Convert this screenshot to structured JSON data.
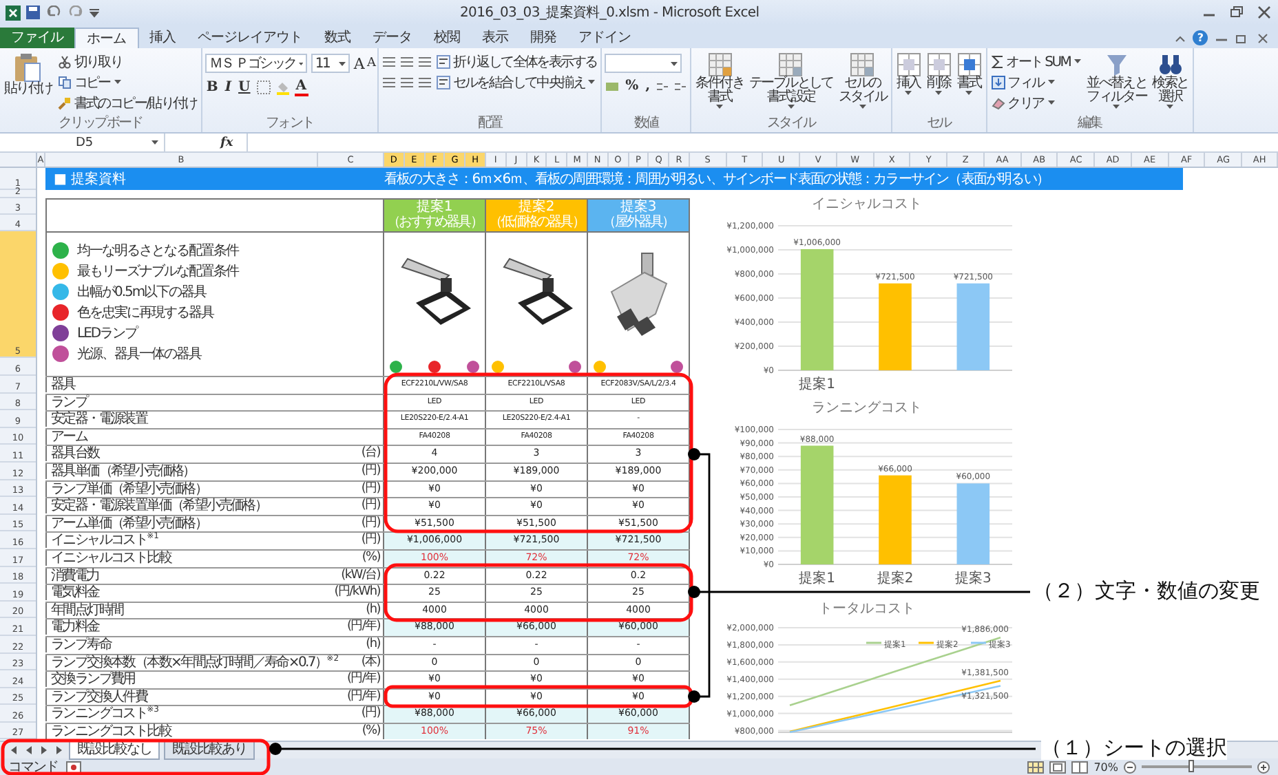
{
  "window": {
    "title": "2016_03_03_提案資料_0.xlsm - Microsoft Excel",
    "help": "?"
  },
  "ribbon_tabs": [
    {
      "label": "ファイル",
      "kind": "file",
      "selected": false
    },
    {
      "label": "ホーム",
      "kind": "tab",
      "selected": true
    },
    {
      "label": "挿入",
      "kind": "tab",
      "selected": false
    },
    {
      "label": "ページレイアウト",
      "kind": "tab",
      "selected": false
    },
    {
      "label": "数式",
      "kind": "tab",
      "selected": false
    },
    {
      "label": "データ",
      "kind": "tab",
      "selected": false
    },
    {
      "label": "校閲",
      "kind": "tab",
      "selected": false
    },
    {
      "label": "表示",
      "kind": "tab",
      "selected": false
    },
    {
      "label": "開発",
      "kind": "tab",
      "selected": false
    },
    {
      "label": "アドイン",
      "kind": "tab",
      "selected": false
    }
  ],
  "ribbon_groups": [
    {
      "kind": "clipboard",
      "label": "クリップボード",
      "paste": "貼り付け",
      "items": [
        {
          "text": "切り取り",
          "dropdown": false
        },
        {
          "text": "コピー",
          "dropdown": true
        },
        {
          "text": "書式のコピー/貼り付け",
          "dropdown": false
        }
      ]
    },
    {
      "kind": "font",
      "label": "フォント",
      "font_name": "ＭＳ Ｐゴシック",
      "font_size": "11",
      "size_buttons": [
        "A",
        "A"
      ],
      "styles": [
        "B",
        "I",
        "U"
      ],
      "color_button": "A"
    },
    {
      "kind": "alignment",
      "label": "配置",
      "items": [
        {
          "text": "折り返して全体を表示する",
          "dropdown": false
        },
        {
          "text": "セルを結合して中央揃え",
          "dropdown": true
        }
      ]
    },
    {
      "kind": "number",
      "label": "数値",
      "symbols": [
        "%",
        ","
      ]
    },
    {
      "kind": "styles",
      "label": "スタイル",
      "items": [
        {
          "lines": [
            "条件付き",
            "書式"
          ],
          "dropdown": true
        },
        {
          "lines": [
            "テーブルとして",
            "書式設定"
          ],
          "dropdown": true
        },
        {
          "lines": [
            "セルの",
            "スタイル"
          ],
          "dropdown": true
        }
      ]
    },
    {
      "kind": "cells",
      "label": "セル",
      "items": [
        {
          "lines": [
            "挿入"
          ],
          "dropdown": true
        },
        {
          "lines": [
            "削除"
          ],
          "dropdown": true
        },
        {
          "lines": [
            "書式"
          ],
          "dropdown": true
        }
      ]
    },
    {
      "kind": "editing",
      "label": "編集",
      "small": [
        {
          "text": "オート SUM",
          "dropdown": true
        },
        {
          "text": "フィル",
          "dropdown": true
        },
        {
          "text": "クリア",
          "dropdown": true
        }
      ],
      "items": [
        {
          "lines": [
            "並べ替えと",
            "フィルター"
          ],
          "dropdown": true
        },
        {
          "lines": [
            "検索と",
            "選択"
          ],
          "dropdown": true
        }
      ]
    }
  ],
  "formula_bar": {
    "name_box": "D5",
    "function_label": "fx"
  },
  "column_headers": [
    {
      "label": "A",
      "selected": false
    },
    {
      "label": "B",
      "selected": false
    },
    {
      "label": "C",
      "selected": false
    },
    {
      "label": "D",
      "selected": true
    },
    {
      "label": "E",
      "selected": true
    },
    {
      "label": "F",
      "selected": true
    },
    {
      "label": "G",
      "selected": true
    },
    {
      "label": "H",
      "selected": true
    },
    {
      "label": "I",
      "selected": false
    },
    {
      "label": "J",
      "selected": false
    },
    {
      "label": "K",
      "selected": false
    },
    {
      "label": "L",
      "selected": false
    },
    {
      "label": "M",
      "selected": false
    },
    {
      "label": "N",
      "selected": false
    },
    {
      "label": "O",
      "selected": false
    },
    {
      "label": "P",
      "selected": false
    },
    {
      "label": "Q",
      "selected": false
    },
    {
      "label": "R",
      "selected": false
    },
    {
      "label": "S",
      "selected": false
    },
    {
      "label": "T",
      "selected": false
    },
    {
      "label": "U",
      "selected": false
    },
    {
      "label": "V",
      "selected": false
    },
    {
      "label": "W",
      "selected": false
    },
    {
      "label": "X",
      "selected": false
    },
    {
      "label": "Y",
      "selected": false
    },
    {
      "label": "Z",
      "selected": false
    },
    {
      "label": "AA",
      "selected": false
    },
    {
      "label": "AB",
      "selected": false
    },
    {
      "label": "AC",
      "selected": false
    },
    {
      "label": "AD",
      "selected": false
    },
    {
      "label": "AE",
      "selected": false
    },
    {
      "label": "AF",
      "selected": false
    },
    {
      "label": "AG",
      "selected": false
    },
    {
      "label": "AH",
      "selected": false
    }
  ],
  "row_headers": [
    {
      "label": "1",
      "selected": false
    },
    {
      "label": "2",
      "selected": false
    },
    {
      "label": "3",
      "selected": false
    },
    {
      "label": "4",
      "selected": false
    },
    {
      "label": "5",
      "selected": true
    },
    {
      "label": "6",
      "selected": false
    },
    {
      "label": "7",
      "selected": false
    },
    {
      "label": "8",
      "selected": false
    },
    {
      "label": "9",
      "selected": false
    },
    {
      "label": "10",
      "selected": false
    },
    {
      "label": "11",
      "selected": false
    },
    {
      "label": "12",
      "selected": false
    },
    {
      "label": "13",
      "selected": false
    },
    {
      "label": "14",
      "selected": false
    },
    {
      "label": "15",
      "selected": false
    },
    {
      "label": "16",
      "selected": false
    },
    {
      "label": "17",
      "selected": false
    },
    {
      "label": "18",
      "selected": false
    },
    {
      "label": "19",
      "selected": false
    },
    {
      "label": "20",
      "selected": false
    },
    {
      "label": "21",
      "selected": false
    },
    {
      "label": "22",
      "selected": false
    },
    {
      "label": "23",
      "selected": false
    },
    {
      "label": "24",
      "selected": false
    },
    {
      "label": "25",
      "selected": false
    },
    {
      "label": "26",
      "selected": false
    },
    {
      "label": "27",
      "selected": false
    }
  ],
  "sheet": {
    "title": "■ 提案資料",
    "conditions": "看板の大きさ：6ｍ×6ｍ、看板の周囲環境：周囲が明るい、サインボード表面の状態：カラーサイン（表面が明るい）",
    "proposals": [
      {
        "name": "提案1",
        "subtitle": "（おすすめ器具）",
        "color": "#92d050",
        "badges": [
          {
            "color": "#2db24a"
          },
          {
            "color": "#e8252a"
          },
          {
            "color": "#c0509a"
          }
        ]
      },
      {
        "name": "提案2",
        "subtitle": "（低価格の器具）",
        "color": "#ffc000",
        "badges": [
          {
            "color": "#ffc000"
          },
          {
            "color": "#c0509a"
          }
        ]
      },
      {
        "name": "提案3",
        "subtitle": "（屋外器具）",
        "color": "#5bb4f0",
        "badges": [
          {
            "color": "#ffc000"
          },
          {
            "color": "#c0509a"
          }
        ]
      }
    ],
    "legend": [
      {
        "text": "均一な明るさとなる配置条件",
        "color": "#2db24a"
      },
      {
        "text": "最もリーズナブルな配置条件",
        "color": "#ffc000"
      },
      {
        "text": "出幅が0.5m以下の器具",
        "color": "#35b8e8"
      },
      {
        "text": "色を忠実に再現する器具",
        "color": "#e8252a"
      },
      {
        "text": "LEDランプ",
        "color": "#7f3f98"
      },
      {
        "text": "光源、器具一体の器具",
        "color": "#c0509a"
      }
    ],
    "rows": [
      {
        "label": "器具",
        "values": [
          "ECF2210L/VW/SA8",
          "ECF2210L/VSA8",
          "ECF2083V/SA/L/2/3.4"
        ],
        "kind": "spec"
      },
      {
        "label": "ランプ",
        "values": [
          "LED",
          "LED",
          "LED"
        ],
        "kind": "spec"
      },
      {
        "label": "安定器・電源装置",
        "values": [
          "LE20S220-E/2.4-A1",
          "LE20S220-E/2.4-A1",
          "-"
        ],
        "kind": "spec"
      },
      {
        "label": "アーム",
        "values": [
          "FA40208",
          "FA40208",
          "FA40208"
        ],
        "kind": "spec"
      },
      {
        "label": "器具台数",
        "unit": "(台)",
        "values": [
          "4",
          "3",
          "3"
        ],
        "kind": "input"
      },
      {
        "label": "器具単価（希望小売価格）",
        "unit": "(円)",
        "values": [
          "¥200,000",
          "¥189,000",
          "¥189,000"
        ],
        "kind": "input"
      },
      {
        "label": "ランプ単価（希望小売価格）",
        "unit": "(円)",
        "values": [
          "¥0",
          "¥0",
          "¥0"
        ],
        "kind": "input"
      },
      {
        "label": "安定器・電源装置単価（希望小売価格）",
        "unit": "(円)",
        "values": [
          "¥0",
          "¥0",
          "¥0"
        ],
        "kind": "input"
      },
      {
        "label": "アーム単価（希望小売価格）",
        "unit": "(円)",
        "values": [
          "¥51,500",
          "¥51,500",
          "¥51,500"
        ],
        "kind": "input"
      },
      {
        "label": "イニシャルコスト$^{※1}$",
        "unit": "(円)",
        "values": [
          "¥1,006,000",
          "¥721,500",
          "¥721,500"
        ],
        "kind": "total"
      },
      {
        "label": "イニシャルコスト比較",
        "unit": "(%)",
        "values": [
          "100%",
          "72%",
          "72%"
        ],
        "kind": "ratio"
      },
      {
        "label": "消費電力",
        "unit": "(kW/台)",
        "values": [
          "0.22",
          "0.22",
          "0.2"
        ],
        "kind": "input"
      },
      {
        "label": "電気料金",
        "unit": "(円/kWh)",
        "values": [
          "25",
          "25",
          "25"
        ],
        "kind": "input"
      },
      {
        "label": "年間点灯時間",
        "unit": "(h)",
        "values": [
          "4000",
          "4000",
          "4000"
        ],
        "kind": "input"
      },
      {
        "label": "電力料金",
        "unit": "(円/年)",
        "values": [
          "¥88,000",
          "¥66,000",
          "¥60,000"
        ],
        "kind": "total"
      },
      {
        "label": "ランプ寿命",
        "unit": "(h)",
        "values": [
          "-",
          "-",
          "-"
        ],
        "kind": "input"
      },
      {
        "label": "ランプ交換本数（本数×年間点灯時間／寿命×0.7）$^{※2}$",
        "unit": "(本)",
        "values": [
          "0",
          "0",
          "0"
        ],
        "kind": "input"
      },
      {
        "label": "交換ランプ費用",
        "unit": "(円/年)",
        "values": [
          "¥0",
          "¥0",
          "¥0"
        ],
        "kind": "input"
      },
      {
        "label": "ランプ交換人件費",
        "unit": "(円/年)",
        "values": [
          "¥0",
          "¥0",
          "¥0"
        ],
        "kind": "input"
      },
      {
        "label": "ランニングコスト$^{※3}$",
        "unit": "(円)",
        "values": [
          "¥88,000",
          "¥66,000",
          "¥60,000"
        ],
        "kind": "total"
      },
      {
        "label": "ランニングコスト比較",
        "unit": "(%)",
        "values": [
          "100%",
          "75%",
          "91%"
        ],
        "kind": "ratio"
      }
    ]
  },
  "charts": [
    {
      "chart_data": {
        "type": "bar",
        "title": "イニシャルコスト",
        "categories": [
          "提案1",
          null,
          null
        ],
        "values": [
          1006000,
          721500,
          721500
        ],
        "colors": [
          "#a5d46a",
          "#ffc000",
          "#8cc8f5"
        ],
        "value_labels": [
          "¥1,006,000",
          "¥721,500",
          "¥721,500"
        ],
        "ylim": [
          0,
          1200000
        ],
        "grid": true,
        "yticks": [
          {
            "value": 0,
            "label": "¥0"
          },
          {
            "value": 200000,
            "label": "¥200,000"
          },
          {
            "value": 400000,
            "label": "¥400,000"
          },
          {
            "value": 600000,
            "label": "¥600,000"
          },
          {
            "value": 800000,
            "label": "¥800,000"
          },
          {
            "value": 1000000,
            "label": "¥1,000,000"
          },
          {
            "value": 1200000,
            "label": "¥1,200,000"
          }
        ]
      }
    },
    {
      "chart_data": {
        "type": "bar",
        "title": "ランニングコスト",
        "categories": [
          "提案1",
          "提案2",
          "提案3"
        ],
        "values": [
          88000,
          66000,
          60000
        ],
        "colors": [
          "#a5d46a",
          "#ffc000",
          "#8cc8f5"
        ],
        "value_labels": [
          "¥88,000",
          "¥66,000",
          "¥60,000"
        ],
        "ylim": [
          0,
          100000
        ],
        "grid": true,
        "yticks": [
          {
            "value": 0,
            "label": "¥0"
          },
          {
            "value": 10000,
            "label": "¥10,000"
          },
          {
            "value": 20000,
            "label": "¥20,000"
          },
          {
            "value": 30000,
            "label": "¥30,000"
          },
          {
            "value": 40000,
            "label": "¥40,000"
          },
          {
            "value": 50000,
            "label": "¥50,000"
          },
          {
            "value": 60000,
            "label": "¥60,000"
          },
          {
            "value": 70000,
            "label": "¥70,000"
          },
          {
            "value": 80000,
            "label": "¥80,000"
          },
          {
            "value": 90000,
            "label": "¥90,000"
          },
          {
            "value": 100000,
            "label": "¥100,000"
          }
        ]
      }
    },
    {
      "chart_data": {
        "type": "line",
        "title": "トータルコスト",
        "ylim": [
          780000,
          2000000
        ],
        "grid": true,
        "legend": true,
        "series": [
          {
            "name": "提案1",
            "color": "#a9d18e",
            "values": [
              1094000,
              1182000,
              1270000,
              1358000,
              1446000,
              1534000,
              1622000,
              1710000,
              1798000,
              1886000
            ]
          },
          {
            "name": "提案2",
            "color": "#ffc000",
            "values": [
              787500,
              853500,
              919500,
              985500,
              1051500,
              1117500,
              1183500,
              1249500,
              1315500,
              1381500
            ]
          },
          {
            "name": "提案3",
            "color": "#8cc8f5",
            "values": [
              781500,
              841500,
              901500,
              961500,
              1021500,
              1081500,
              1141500,
              1201500,
              1261500,
              1321500
            ]
          }
        ],
        "yticks": [
          {
            "value": 800000,
            "label": "¥800,000"
          },
          {
            "value": 1000000,
            "label": "¥1,000,000"
          },
          {
            "value": 1200000,
            "label": "¥1,200,000"
          },
          {
            "value": 1400000,
            "label": "¥1,400,000"
          },
          {
            "value": 1600000,
            "label": "¥1,600,000"
          },
          {
            "value": 1800000,
            "label": "¥1,800,000"
          },
          {
            "value": 2000000,
            "label": "¥2,000,000"
          }
        ],
        "annotations": [
          "¥1,886,000",
          "¥1,381,500",
          "¥1,321,500"
        ]
      }
    }
  ],
  "sheet_tabs": [
    {
      "label": "既設比較なし",
      "selected": true
    },
    {
      "label": "既設比較あり",
      "selected": false
    }
  ],
  "status_bar": {
    "mode": "コマンド",
    "zoom": "70%",
    "zoom_slider": {
      "level": 0.45
    }
  },
  "annotations": [
    {
      "text": "（２）文字・数値の変更"
    },
    {
      "text": "（１）シートの選択"
    }
  ]
}
